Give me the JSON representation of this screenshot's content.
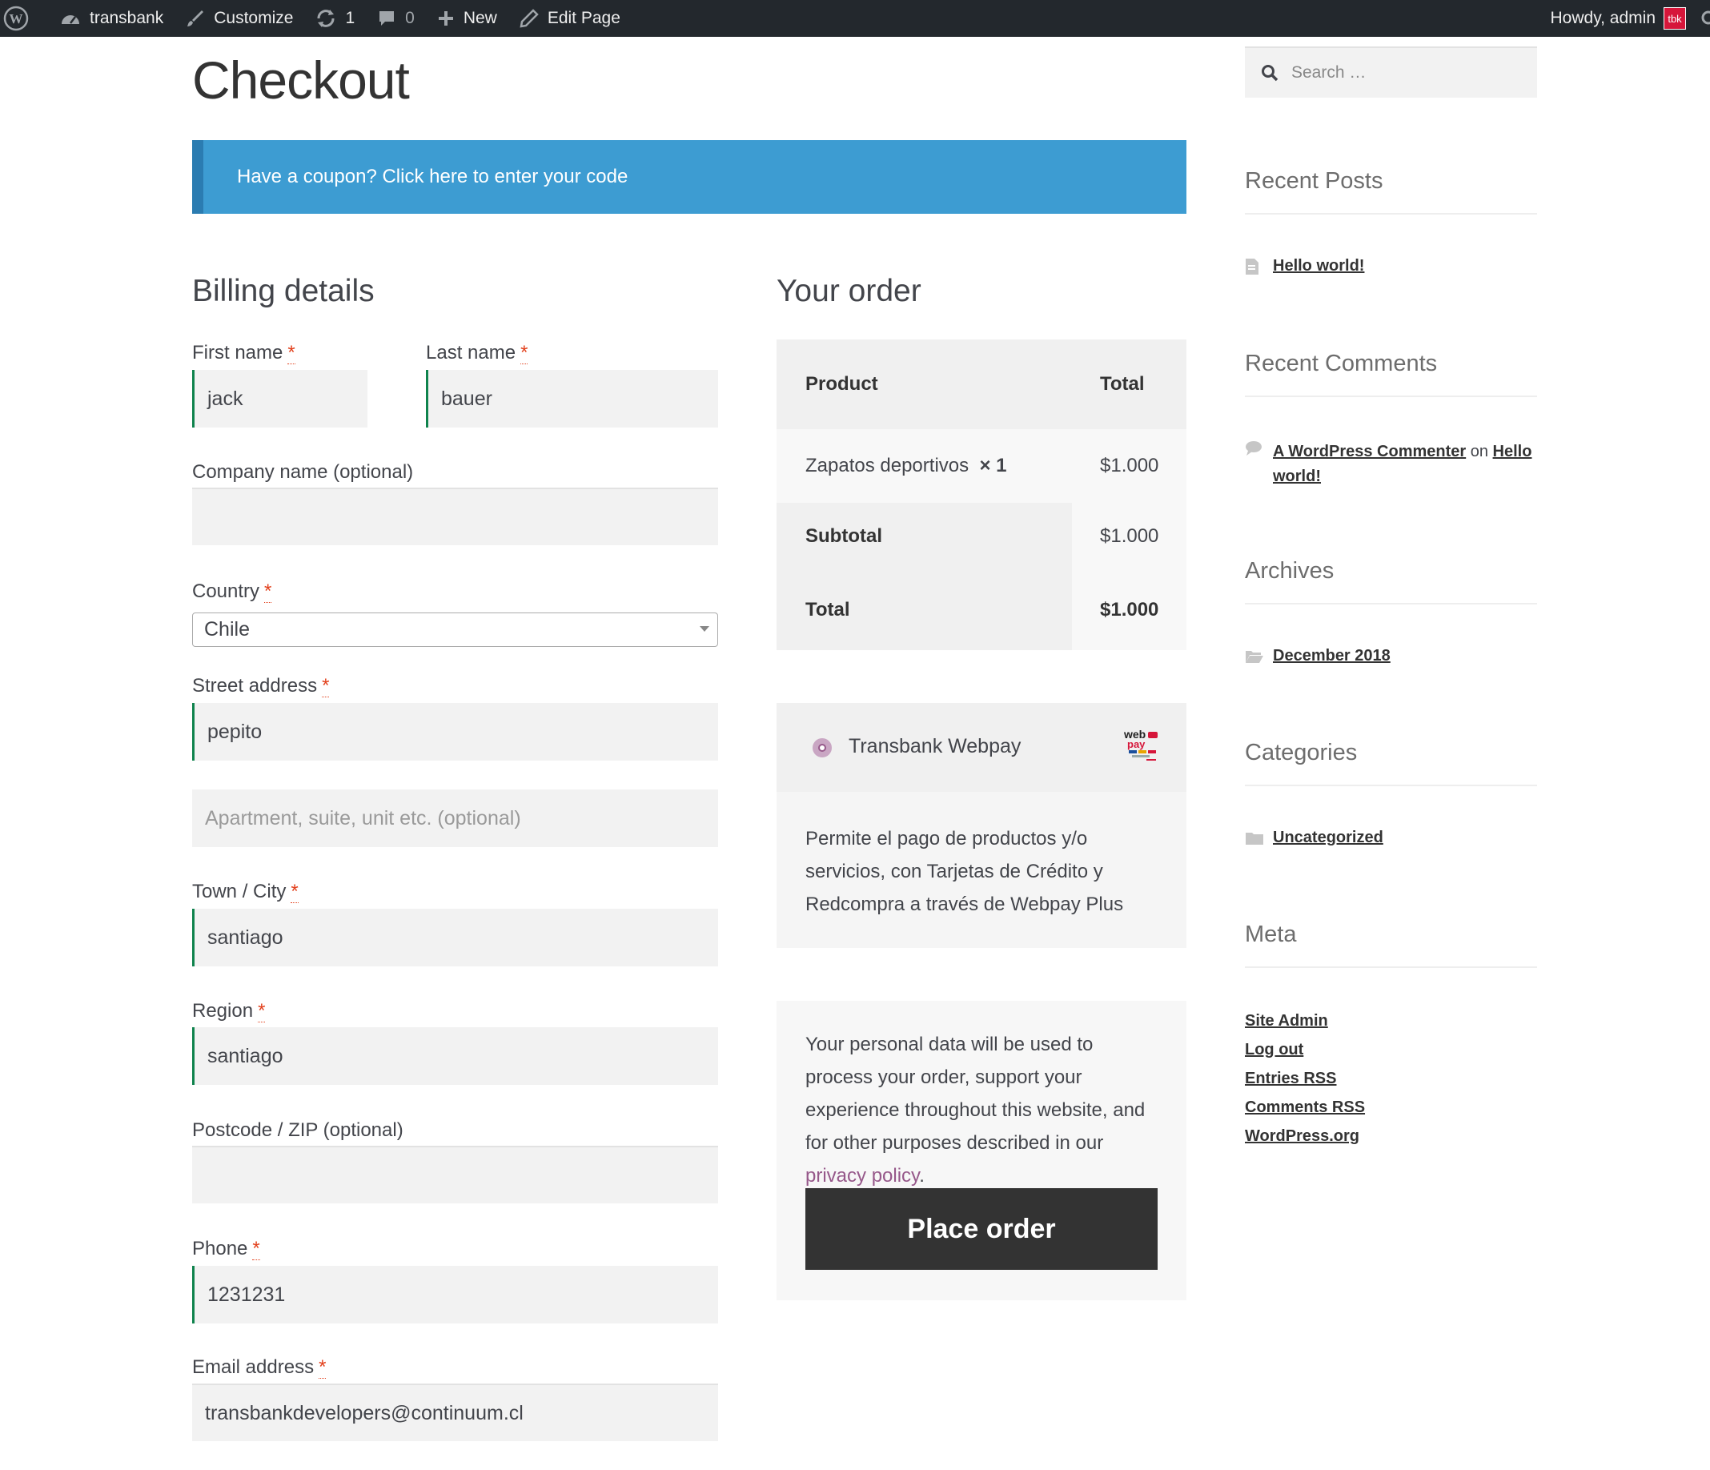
{
  "admin_bar": {
    "site_name": "transbank",
    "customize": "Customize",
    "updates_count": "1",
    "comments_count": "0",
    "new_label": "New",
    "edit_page": "Edit Page",
    "howdy": "Howdy, admin",
    "avatar_text": "tbk"
  },
  "page": {
    "title": "Checkout",
    "coupon_notice": "Have a coupon? Click here to enter your code"
  },
  "billing": {
    "title": "Billing details",
    "required_mark": "*",
    "first_name": {
      "label": "First name",
      "value": "jack"
    },
    "last_name": {
      "label": "Last name",
      "value": "bauer"
    },
    "company": {
      "label": "Company name (optional)",
      "value": ""
    },
    "country": {
      "label": "Country",
      "value": "Chile"
    },
    "street": {
      "label": "Street address",
      "value": "pepito",
      "placeholder2": "Apartment, suite, unit etc. (optional)"
    },
    "city": {
      "label": "Town / City",
      "value": "santiago"
    },
    "region": {
      "label": "Region",
      "value": "santiago"
    },
    "postcode": {
      "label": "Postcode / ZIP (optional)",
      "value": ""
    },
    "phone": {
      "label": "Phone",
      "value": "1231231"
    },
    "email": {
      "label": "Email address",
      "value": "transbankdevelopers@continuum.cl"
    }
  },
  "order": {
    "title": "Your order",
    "headers": {
      "product": "Product",
      "total": "Total"
    },
    "item": {
      "name": "Zapatos deportivos",
      "qty": "× 1",
      "total": "$1.000"
    },
    "subtotal": {
      "label": "Subtotal",
      "value": "$1.000"
    },
    "total": {
      "label": "Total",
      "value": "$1.000"
    }
  },
  "payment": {
    "method": "Transbank Webpay",
    "logo_text": "web pay",
    "description": "Permite el pago de productos y/o servicios, con Tarjetas de Crédito y Redcompra a través de Webpay Plus",
    "terms_text": "Your personal data will be used to process your order, support your experience throughout this website, and for other purposes described in our",
    "privacy_link": "privacy policy",
    "terms_end": ".",
    "place_order": "Place order"
  },
  "sidebar": {
    "search_placeholder": "Search …",
    "recent_posts": {
      "title": "Recent Posts",
      "items": [
        "Hello world!"
      ]
    },
    "recent_comments": {
      "title": "Recent Comments",
      "author": "A WordPress Commenter",
      "on": "on",
      "post": "Hello world!"
    },
    "archives": {
      "title": "Archives",
      "items": [
        "December 2018"
      ]
    },
    "categories": {
      "title": "Categories",
      "items": [
        "Uncategorized"
      ]
    },
    "meta": {
      "title": "Meta",
      "items": [
        "Site Admin",
        "Log out",
        "Entries RSS",
        "Comments RSS",
        "WordPress.org"
      ]
    }
  },
  "colors": {
    "admin_bar": "#23282d",
    "coupon": "#3d9cd2",
    "valid_border": "#0f834d",
    "required": "#e2401c",
    "link_purple": "#96588a",
    "button": "#333333"
  }
}
